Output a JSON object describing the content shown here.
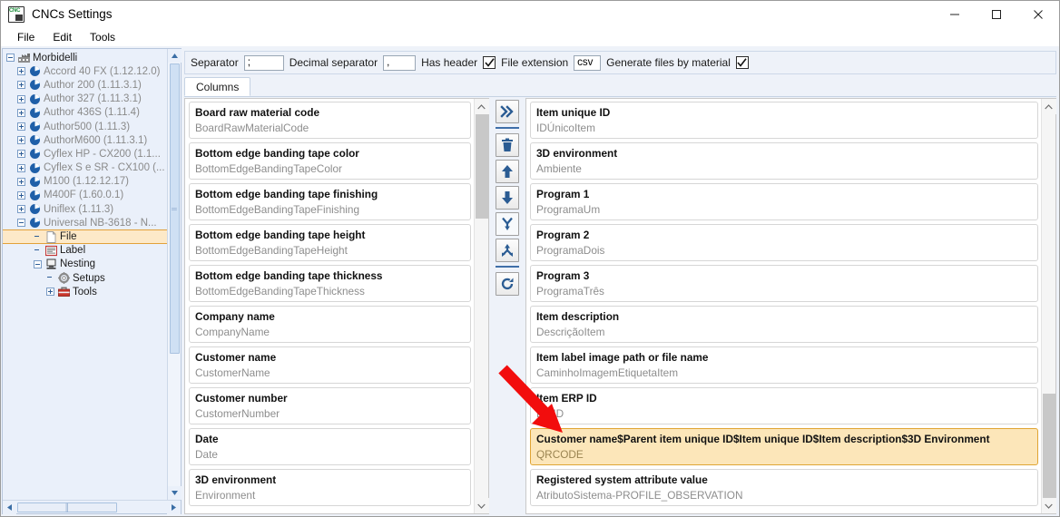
{
  "window": {
    "title": "CNCs Settings",
    "icon": "cnc-app-icon",
    "minimize_label": "–",
    "maximize_label": "□",
    "close_label": "✕"
  },
  "menubar": {
    "items": [
      {
        "label": "File"
      },
      {
        "label": "Edit"
      },
      {
        "label": "Tools"
      }
    ]
  },
  "tree": {
    "nodes": [
      {
        "label": "Morbidelli",
        "level": 0,
        "expander": "minus",
        "icon": "factory-icon",
        "selected": false,
        "dim": false
      },
      {
        "label": "Accord 40 FX (1.12.12.0)",
        "level": 1,
        "expander": "plus",
        "icon": "machine-icon",
        "selected": false,
        "dim": true
      },
      {
        "label": "Author 200 (1.11.3.1)",
        "level": 1,
        "expander": "plus",
        "icon": "machine-icon",
        "selected": false,
        "dim": true
      },
      {
        "label": "Author 327 (1.11.3.1)",
        "level": 1,
        "expander": "plus",
        "icon": "machine-icon",
        "selected": false,
        "dim": true
      },
      {
        "label": "Author 436S (1.11.4)",
        "level": 1,
        "expander": "plus",
        "icon": "machine-icon",
        "selected": false,
        "dim": true
      },
      {
        "label": "Author500 (1.11.3)",
        "level": 1,
        "expander": "plus",
        "icon": "machine-icon",
        "selected": false,
        "dim": true
      },
      {
        "label": "AuthorM600 (1.11.3.1)",
        "level": 1,
        "expander": "plus",
        "icon": "machine-icon",
        "selected": false,
        "dim": true
      },
      {
        "label": "Cyflex HP - CX200 (1.1...",
        "level": 1,
        "expander": "plus",
        "icon": "machine-icon",
        "selected": false,
        "dim": true
      },
      {
        "label": "Cyflex S e SR - CX100 (...",
        "level": 1,
        "expander": "plus",
        "icon": "machine-icon",
        "selected": false,
        "dim": true
      },
      {
        "label": "M100 (1.12.12.17)",
        "level": 1,
        "expander": "plus",
        "icon": "machine-icon",
        "selected": false,
        "dim": true
      },
      {
        "label": "M400F (1.60.0.1)",
        "level": 1,
        "expander": "plus",
        "icon": "machine-icon",
        "selected": false,
        "dim": true
      },
      {
        "label": "Uniflex (1.11.3)",
        "level": 1,
        "expander": "plus",
        "icon": "machine-icon",
        "selected": false,
        "dim": true
      },
      {
        "label": "Universal NB-3618 - N...",
        "level": 1,
        "expander": "minus",
        "icon": "machine-icon",
        "selected": false,
        "dim": false
      },
      {
        "label": "File",
        "level": 2,
        "expander": "none",
        "icon": "file-icon",
        "selected": true,
        "dim": false
      },
      {
        "label": "Label",
        "level": 2,
        "expander": "none",
        "icon": "label-icon",
        "selected": false,
        "dim": false
      },
      {
        "label": "Nesting",
        "level": 2,
        "expander": "minus",
        "icon": "nesting-icon",
        "selected": false,
        "dim": false
      },
      {
        "label": "Setups",
        "level": 3,
        "expander": "none",
        "icon": "gear-icon",
        "selected": false,
        "dim": false
      },
      {
        "label": "Tools",
        "level": 3,
        "expander": "plus",
        "icon": "toolbox-icon",
        "selected": false,
        "dim": false
      }
    ]
  },
  "options": {
    "separator_label": "Separator",
    "separator_value": ";",
    "decimal_label": "Decimal separator",
    "decimal_value": ",",
    "has_header_label": "Has header",
    "has_header_checked": true,
    "file_extension_label": "File extension",
    "file_extension_value": "csv",
    "generate_files_label": "Generate files by material",
    "generate_files_checked": true
  },
  "tabs": [
    {
      "label": "Columns",
      "active": true
    }
  ],
  "toolbar_buttons": [
    {
      "name": "move-right-button",
      "icon": "double-chevron-right-icon",
      "separator_after": true
    },
    {
      "name": "delete-button",
      "icon": "trash-icon",
      "separator_after": false
    },
    {
      "name": "move-up-button",
      "icon": "arrow-up-icon",
      "separator_after": false
    },
    {
      "name": "move-down-button",
      "icon": "arrow-down-icon",
      "separator_after": false
    },
    {
      "name": "merge-button",
      "icon": "merge-y-icon",
      "separator_after": false
    },
    {
      "name": "split-button",
      "icon": "split-y-icon",
      "separator_after": true
    },
    {
      "name": "refresh-button",
      "icon": "refresh-icon",
      "separator_after": false
    }
  ],
  "available_columns": {
    "items": [
      {
        "title": "Board raw material code",
        "code": "BoardRawMaterialCode"
      },
      {
        "title": "Bottom edge banding tape color",
        "code": "BottomEdgeBandingTapeColor"
      },
      {
        "title": "Bottom edge banding tape finishing",
        "code": "BottomEdgeBandingTapeFinishing"
      },
      {
        "title": "Bottom edge banding tape height",
        "code": "BottomEdgeBandingTapeHeight"
      },
      {
        "title": "Bottom edge banding tape thickness",
        "code": "BottomEdgeBandingTapeThickness"
      },
      {
        "title": "Company name",
        "code": "CompanyName"
      },
      {
        "title": "Customer name",
        "code": "CustomerName"
      },
      {
        "title": "Customer number",
        "code": "CustomerNumber"
      },
      {
        "title": "Date",
        "code": "Date"
      },
      {
        "title": "3D environment",
        "code": "Environment"
      }
    ]
  },
  "selected_columns": {
    "items": [
      {
        "title": "Item unique ID",
        "code": "IDÚnicoItem",
        "highlighted": false
      },
      {
        "title": "3D environment",
        "code": "Ambiente",
        "highlighted": false
      },
      {
        "title": "Program 1",
        "code": "ProgramaUm",
        "highlighted": false
      },
      {
        "title": "Program 2",
        "code": "ProgramaDois",
        "highlighted": false
      },
      {
        "title": "Program 3",
        "code": "ProgramaTrês",
        "highlighted": false
      },
      {
        "title": "Item description",
        "code": "DescriçãoItem",
        "highlighted": false
      },
      {
        "title": "Item label image path or file name",
        "code": "CaminhoImagemEtiquetaItem",
        "highlighted": false
      },
      {
        "title": "Item ERP ID",
        "code": "ErpID",
        "highlighted": false
      },
      {
        "title": "Customer name$Parent item unique ID$Item unique ID$Item description$3D Environment",
        "code": "QRCODE",
        "highlighted": true
      },
      {
        "title": "Registered system attribute value",
        "code": "AtributoSistema-PROFILE_OBSERVATION",
        "highlighted": false
      }
    ]
  },
  "annotation": {
    "arrow_color": "#f20d0d",
    "points_to": "QRCODE row"
  }
}
